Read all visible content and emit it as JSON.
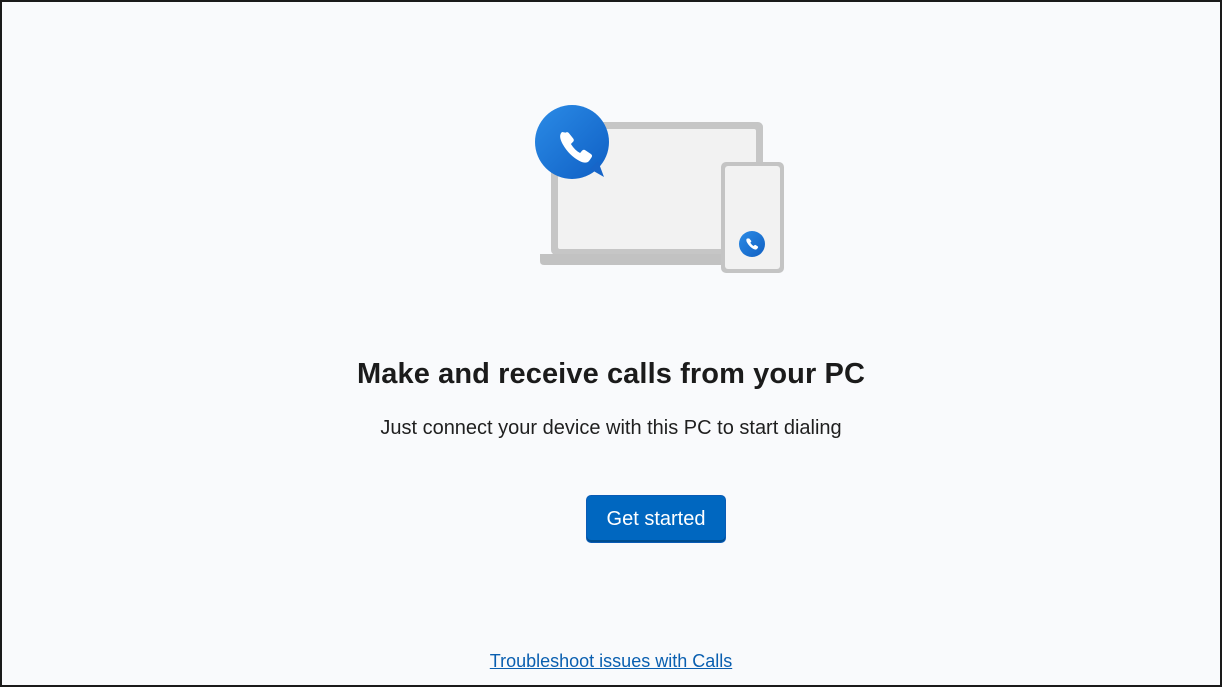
{
  "empty_state": {
    "illustration_icon": "laptop-phone-call-icon",
    "headline": "Make and receive calls from your PC",
    "subtitle": "Just connect your device with this PC to start dialing",
    "primary_button_label": "Get started",
    "troubleshoot_link": "Troubleshoot issues with Calls"
  },
  "colors": {
    "background": "#f9fafc",
    "accent": "#0067c0",
    "link": "#0a5fb0",
    "text": "#1b1b1b"
  }
}
